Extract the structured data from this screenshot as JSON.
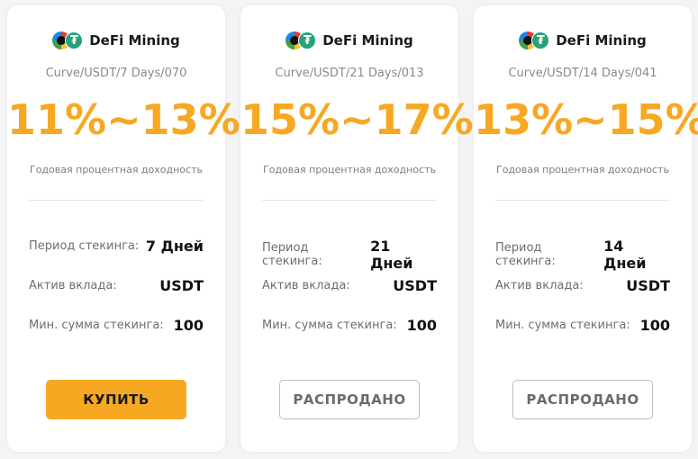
{
  "cards": [
    {
      "brand": "DeFi Mining",
      "tether_symbol": "₮",
      "subtitle": "Curve/USDT/7 Days/070",
      "rate": "11%~13%",
      "rate_label": "Годовая процентная доходность",
      "rows": [
        {
          "label": "Период стекинга:",
          "value": "7 Дней"
        },
        {
          "label": "Актив вклада:",
          "value": "USDT"
        },
        {
          "label": "Мин. сумма стекинга:",
          "value": "100"
        }
      ],
      "button": "КУПИТЬ"
    },
    {
      "brand": "DeFi Mining",
      "tether_symbol": "₮",
      "subtitle": "Curve/USDT/21 Days/013",
      "rate": "15%~17%",
      "rate_label": "Годовая процентная доходность",
      "rows": [
        {
          "label": "Период стекинга:",
          "value": "21 Дней"
        },
        {
          "label": "Актив вклада:",
          "value": "USDT"
        },
        {
          "label": "Мин. сумма стекинга:",
          "value": "100"
        }
      ],
      "button": "РАСПРОДАНО"
    },
    {
      "brand": "DeFi Mining",
      "tether_symbol": "₮",
      "subtitle": "Curve/USDT/14 Days/041",
      "rate": "13%~15%",
      "rate_label": "Годовая процентная доходность",
      "rows": [
        {
          "label": "Период стекинга:",
          "value": "14 Дней"
        },
        {
          "label": "Актив вклада:",
          "value": "USDT"
        },
        {
          "label": "Мин. сумма стекинга:",
          "value": "100"
        }
      ],
      "button": "РАСПРОДАНО"
    }
  ],
  "colors": {
    "accent": "#f7a823",
    "tether": "#26a17b",
    "background": "#f4f4f6"
  }
}
